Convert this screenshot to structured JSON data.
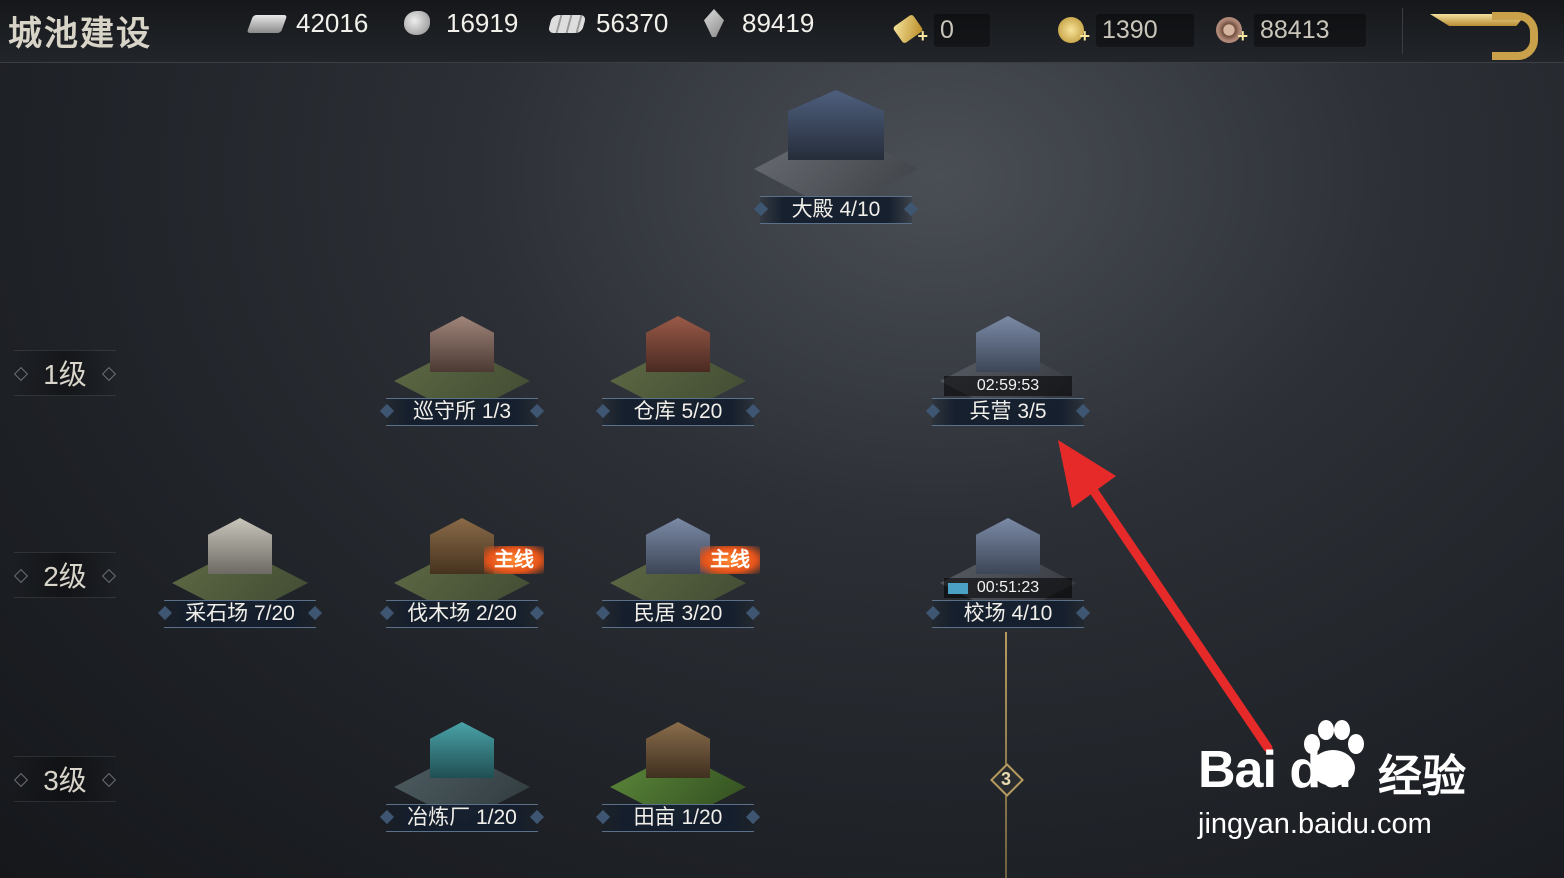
{
  "header": {
    "title": "城池建设",
    "resources": [
      {
        "icon": "stone-icon",
        "value": "42016"
      },
      {
        "icon": "ore-icon",
        "value": "16919"
      },
      {
        "icon": "wood-icon",
        "value": "56370"
      },
      {
        "icon": "grain-icon",
        "value": "89419"
      }
    ],
    "currencies": [
      {
        "icon": "gold-ingot-icon",
        "value": "0"
      },
      {
        "icon": "gold-coin-icon",
        "value": "1390"
      },
      {
        "icon": "copper-coin-icon",
        "value": "88413"
      }
    ],
    "back_icon": "return-arrow-icon"
  },
  "tiers": [
    {
      "label": "1级"
    },
    {
      "label": "2级"
    },
    {
      "label": "3级"
    }
  ],
  "buildings": {
    "great_hall": {
      "label": "大殿 4/10"
    },
    "patrol": {
      "label": "巡守所 1/3"
    },
    "warehouse": {
      "label": "仓库 5/20"
    },
    "barracks": {
      "label": "兵营 3/5",
      "timer": "02:59:53"
    },
    "quarry": {
      "label": "采石场 7/20"
    },
    "lumber": {
      "label": "伐木场 2/20",
      "badge": "主线"
    },
    "housing": {
      "label": "民居 3/20",
      "badge": "主线"
    },
    "drill": {
      "label": "校场 4/10",
      "timer": "00:51:23"
    },
    "smelter": {
      "label": "冶炼厂 1/20"
    },
    "farm": {
      "label": "田亩 1/20"
    }
  },
  "tech_node": {
    "value": "3"
  },
  "watermark": {
    "logo": "Bai du",
    "brand": "经验",
    "url": "jingyan.baidu.com"
  },
  "colors": {
    "accent_gold": "#c9a14a",
    "badge_orange": "#e5531a",
    "arrow_red": "#e62a2a"
  }
}
